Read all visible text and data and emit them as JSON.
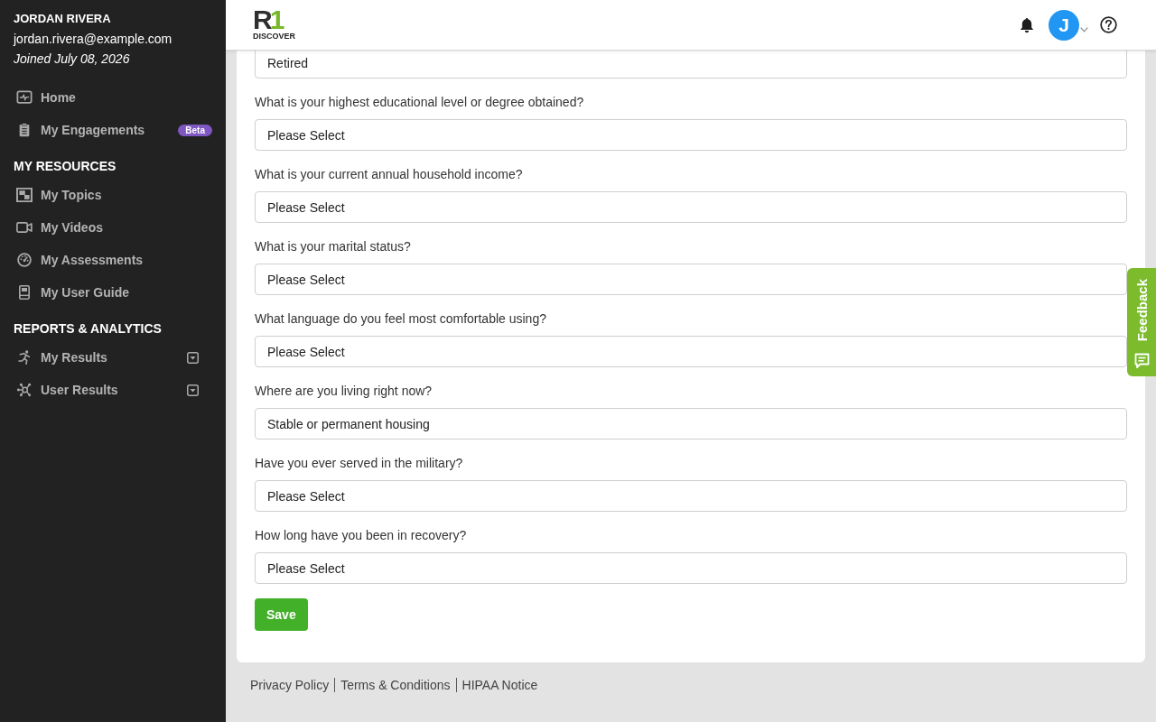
{
  "sidebar": {
    "user": {
      "name": "JORDAN RIVERA",
      "email": "jordan.rivera@example.com",
      "joined": "Joined July 08, 2026"
    },
    "sections": [
      {
        "items": [
          {
            "label": "Home",
            "selected": false
          },
          {
            "label": "My Engagements",
            "selected": false,
            "badge": "Beta"
          }
        ]
      },
      {
        "heading": "MY RESOURCES",
        "items": [
          {
            "label": "My Topics",
            "selected": false
          },
          {
            "label": "My Videos",
            "selected": false
          },
          {
            "label": "My Assessments",
            "selected": false
          },
          {
            "label": "My User Guide",
            "selected": false
          }
        ]
      },
      {
        "heading": "REPORTS & ANALYTICS",
        "items": [
          {
            "label": "My Results",
            "selected": false,
            "expanded": false
          },
          {
            "label": "User Results",
            "selected": false,
            "expanded": false
          }
        ]
      }
    ]
  },
  "header": {
    "logo": {
      "mark": [
        "R",
        "1"
      ],
      "caption": "DISCOVER"
    },
    "avatar": {
      "initial": "J"
    }
  },
  "form": {
    "fields": [
      {
        "value": "Retired"
      },
      {
        "label": "What is your highest educational level or degree obtained?",
        "value": "Please Select"
      },
      {
        "label": "What is your current annual household income?",
        "value": "Please Select"
      },
      {
        "label": "What is your marital status?",
        "value": "Please Select"
      },
      {
        "label": "What language do you feel most comfortable using?",
        "value": "Please Select"
      },
      {
        "label": "Where are you living right now?",
        "value": "Stable or permanent housing"
      },
      {
        "label": "Have you ever served in the military?",
        "value": "Please Select"
      },
      {
        "label": "How long have you been in recovery?",
        "value": "Please Select"
      }
    ],
    "save_button": "Save"
  },
  "footer": {
    "links": [
      "Privacy Policy",
      "Terms & Conditions",
      "HIPAA Notice"
    ]
  },
  "feedback_tab": {
    "label": "Feedback"
  }
}
